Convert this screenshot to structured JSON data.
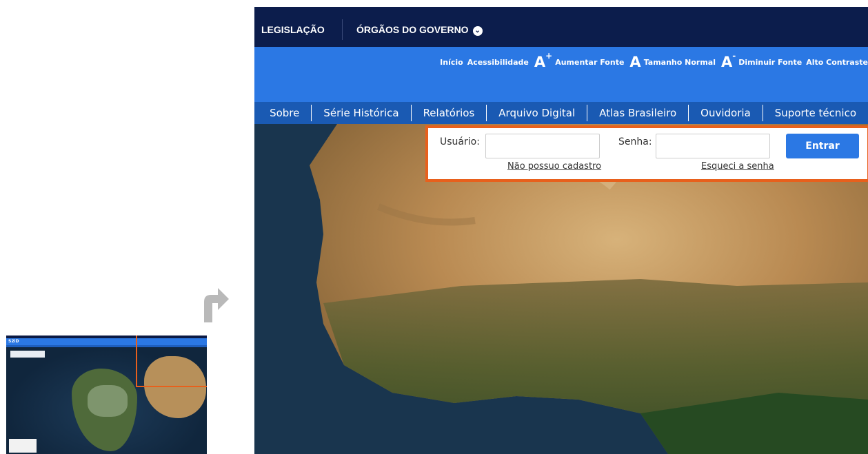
{
  "gov_bar": {
    "legislacao": "LEGISLAÇÃO",
    "orgaos": "ÓRGÃOS DO GOVERNO"
  },
  "accessibility": {
    "inicio": "Início",
    "acessibilidade": "Acessibilidade",
    "aumentar_symbol": "A",
    "aumentar_sup": "+",
    "aumentar": "Aumentar Fonte",
    "normal_symbol": "A",
    "normal": "Tamanho Normal",
    "diminuir_symbol": "A",
    "diminuir_sup": "-",
    "diminuir": "Diminuir Fonte",
    "alto_contraste": "Alto Contraste"
  },
  "menu": {
    "items": [
      "Sobre",
      "Série Histórica",
      "Relatórios",
      "Arquivo Digital",
      "Atlas Brasileiro",
      "Ouvidoria",
      "Suporte técnico"
    ]
  },
  "login": {
    "usuario_label": "Usuário:",
    "usuario_value": "",
    "senha_label": "Senha:",
    "senha_value": "",
    "no_account_link": "Não possuo cadastro",
    "forgot_link": "Esqueci a senha",
    "submit": "Entrar"
  },
  "thumbnail": {
    "logo": "S2iD"
  },
  "colors": {
    "gov_bar": "#0c1d4c",
    "accent_blue": "#2b78e4",
    "menu_blue": "#1a5ab3",
    "highlight": "#e8601c"
  }
}
